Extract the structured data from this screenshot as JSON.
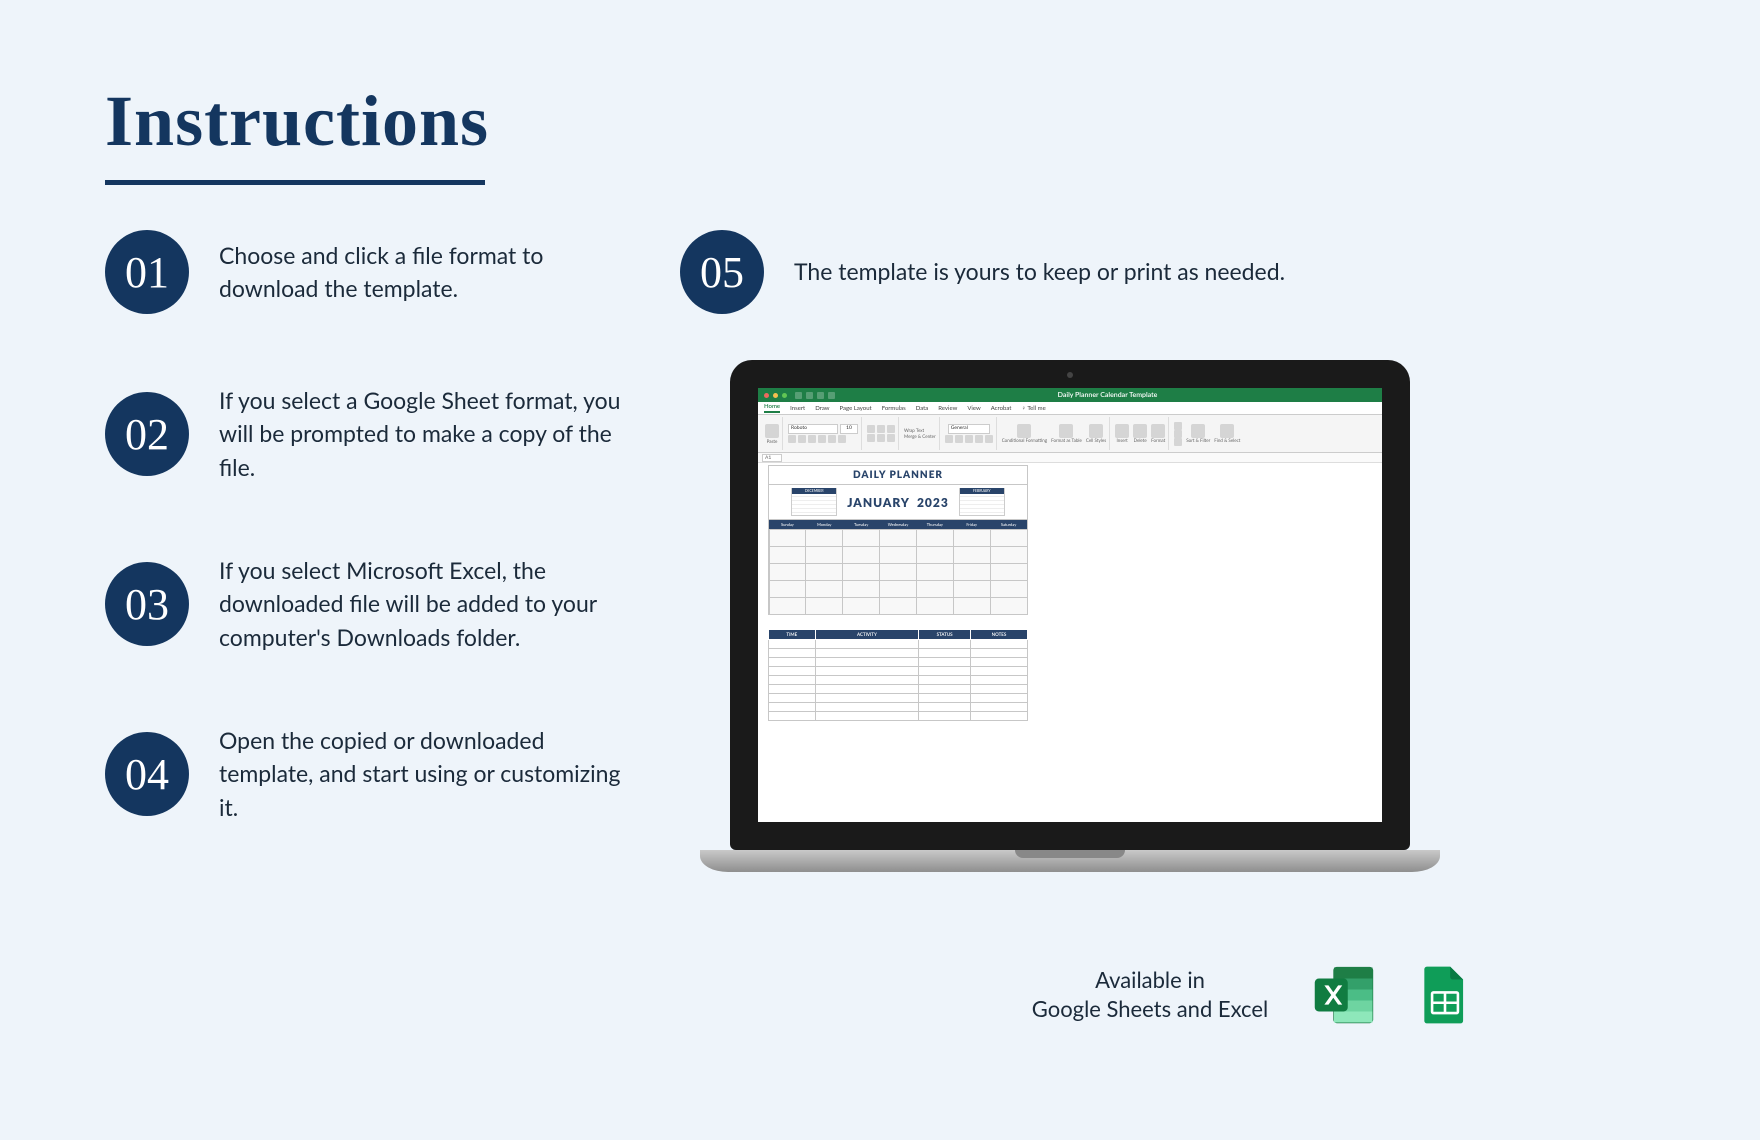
{
  "title": "Instructions",
  "steps": [
    {
      "num": "01",
      "text": "Choose and click a file format to download the template."
    },
    {
      "num": "02",
      "text": "If you select a Google Sheet format, you will be prompted to make a copy of the file."
    },
    {
      "num": "03",
      "text": "If you select Microsoft Excel, the downloaded file will be added to your computer's Downloads folder."
    },
    {
      "num": "04",
      "text": "Open the copied or downloaded template, and start using or customizing it."
    },
    {
      "num": "05",
      "text": "The template is yours to keep or print as needed."
    }
  ],
  "excel": {
    "file_title": "Daily Planner Calendar Template",
    "tabs": [
      "Home",
      "Insert",
      "Draw",
      "Page Layout",
      "Formulas",
      "Data",
      "Review",
      "View",
      "Acrobat",
      "Tell me"
    ],
    "tell_me_prefix": "♀",
    "font_name": "Roboto",
    "font_size": "10",
    "paste_label": "Paste",
    "ribbon_alignment": [
      "Wrap Text",
      "Merge & Center"
    ],
    "ribbon_number": "General",
    "ribbon_styles": [
      "Conditional Formatting",
      "Format as Table",
      "Cell Styles"
    ],
    "ribbon_cells": [
      "Insert",
      "Delete",
      "Format"
    ],
    "ribbon_editing": [
      "Sort & Filter",
      "Find & Select"
    ],
    "name_box": "A1",
    "planner": {
      "title": "DAILY PLANNER",
      "month": "JANUARY",
      "year": "2023",
      "mini_prev": "DECEMBER",
      "mini_next": "FEBRUARY",
      "weekdays": [
        "Sunday",
        "Monday",
        "Tuesday",
        "Wednesday",
        "Thursday",
        "Friday",
        "Saturday"
      ],
      "task_cols": [
        "TIME",
        "ACTIVITY",
        "STATUS",
        "NOTES"
      ]
    }
  },
  "availability": {
    "text": "Available in\nGoogle Sheets and Excel"
  }
}
